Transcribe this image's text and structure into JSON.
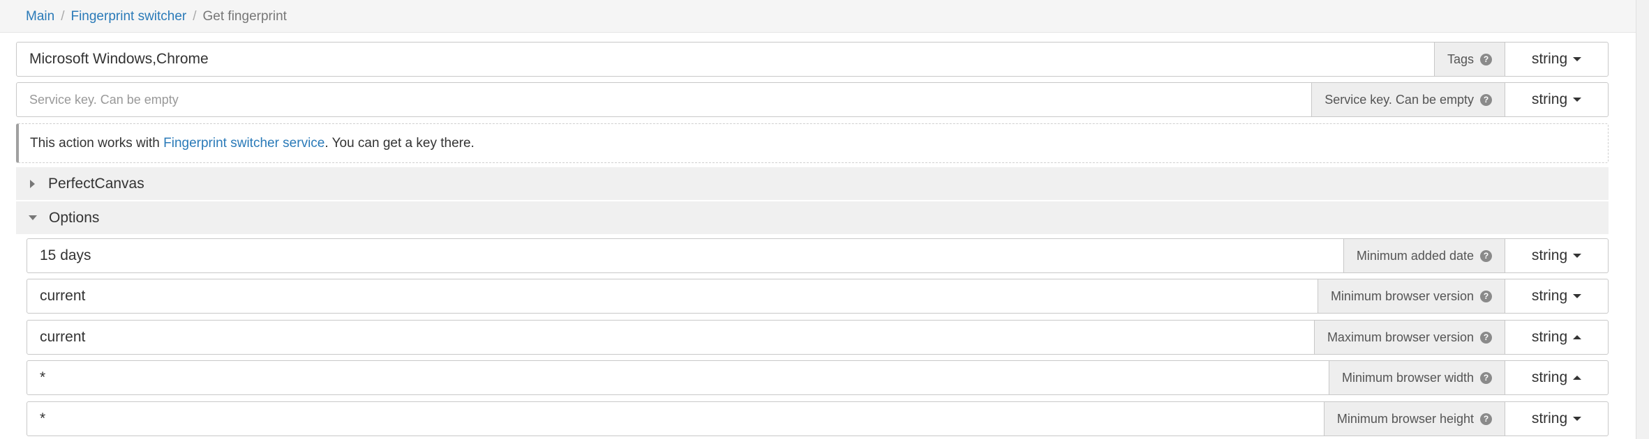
{
  "breadcrumb": {
    "main": "Main",
    "parent": "Fingerprint switcher",
    "current": "Get fingerprint",
    "sep": "/"
  },
  "fields": [
    {
      "value": "Microsoft Windows,Chrome",
      "label": "Tags",
      "type": "string"
    },
    {
      "placeholder": "Service key. Can be empty",
      "label": "Service key. Can be empty",
      "type": "string"
    }
  ],
  "info": {
    "prefix": "This action works with ",
    "link": "Fingerprint switcher service",
    "suffix": ". You can get a key there."
  },
  "sections": {
    "perfect_canvas": "PerfectCanvas",
    "options": "Options"
  },
  "options": [
    {
      "value": "15 days",
      "label": "Minimum added date",
      "type": "string"
    },
    {
      "value": "current",
      "label": "Minimum browser version",
      "type": "string"
    },
    {
      "value": "current",
      "label": "Maximum browser version",
      "type": "string"
    },
    {
      "value": "*",
      "label": "Minimum browser width",
      "type": "string"
    },
    {
      "value": "*",
      "label": "Minimum browser height",
      "type": "string"
    }
  ],
  "icons": {
    "help": "question-circle-icon",
    "caret": "caret-icon",
    "expand": "triangle-icon"
  }
}
